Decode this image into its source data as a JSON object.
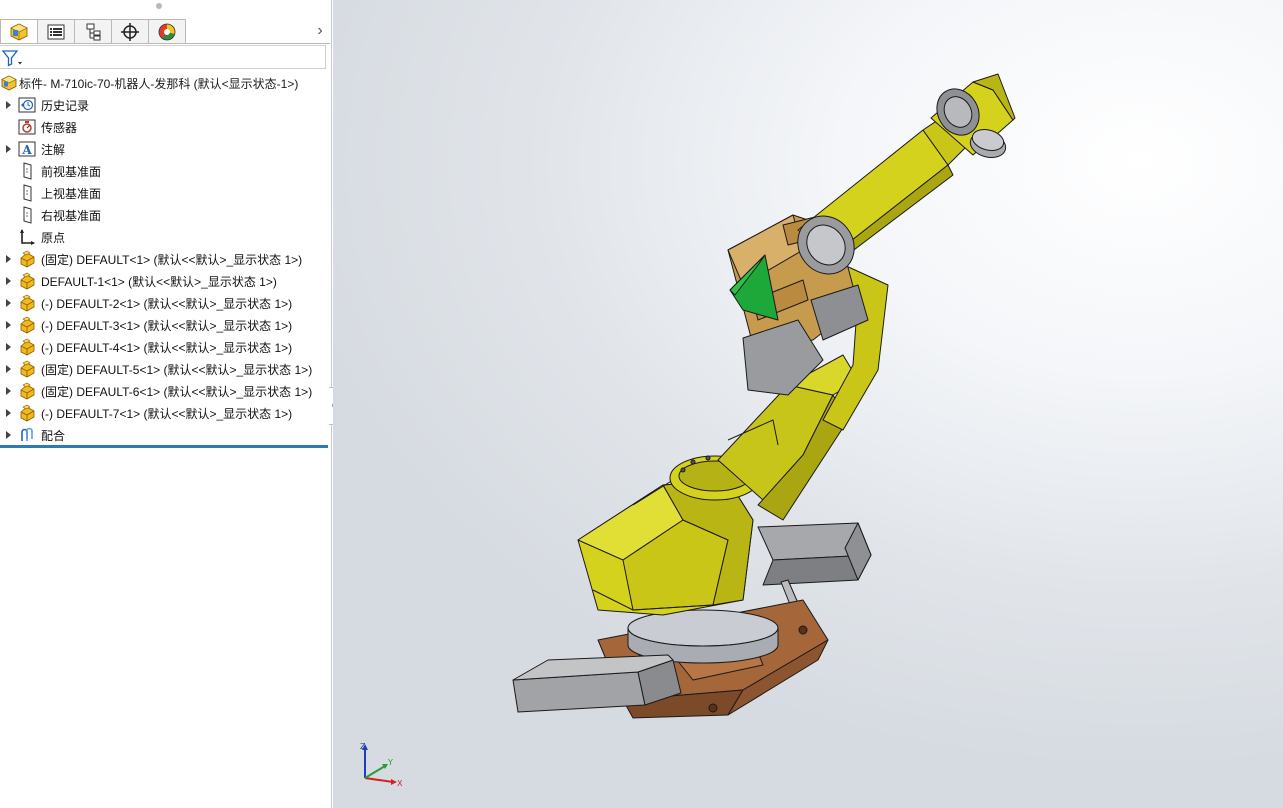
{
  "panel": {
    "tabs": [
      {
        "name": "feature-manager",
        "icon": "featuremanager-icon",
        "active": true
      },
      {
        "name": "property-manager",
        "icon": "propertymanager-icon",
        "active": false
      },
      {
        "name": "configuration-manager",
        "icon": "configurationmanager-icon",
        "active": false
      },
      {
        "name": "dimxpert-manager",
        "icon": "dimxpert-icon",
        "active": false
      },
      {
        "name": "display-manager",
        "icon": "displaymanager-icon",
        "active": false
      }
    ],
    "more_arrow": "›",
    "root_label": "标件- M-710ic-70-机器人-发那科 (默认<显示状态-1>)",
    "tree": [
      {
        "label": "历史记录",
        "icon": "history-icon",
        "expandable": true
      },
      {
        "label": "传感器",
        "icon": "sensor-icon",
        "expandable": false
      },
      {
        "label": "注解",
        "icon": "annotation-icon",
        "expandable": true
      },
      {
        "label": "前视基准面",
        "icon": "plane-icon",
        "expandable": false
      },
      {
        "label": "上视基准面",
        "icon": "plane-icon",
        "expandable": false
      },
      {
        "label": "右视基准面",
        "icon": "plane-icon",
        "expandable": false
      },
      {
        "label": "原点",
        "icon": "origin-icon",
        "expandable": false
      },
      {
        "label": "(固定) DEFAULT<1> (默认<<默认>_显示状态 1>)",
        "icon": "part-icon",
        "expandable": true
      },
      {
        "label": "DEFAULT-1<1> (默认<<默认>_显示状态 1>)",
        "icon": "part-icon",
        "expandable": true
      },
      {
        "label": "(-) DEFAULT-2<1> (默认<<默认>_显示状态 1>)",
        "icon": "part-icon",
        "expandable": true
      },
      {
        "label": "(-) DEFAULT-3<1> (默认<<默认>_显示状态 1>)",
        "icon": "part-icon",
        "expandable": true
      },
      {
        "label": "(-) DEFAULT-4<1> (默认<<默认>_显示状态 1>)",
        "icon": "part-icon",
        "expandable": true
      },
      {
        "label": "(固定) DEFAULT-5<1> (默认<<默认>_显示状态 1>)",
        "icon": "part-icon",
        "expandable": true
      },
      {
        "label": "(固定) DEFAULT-6<1> (默认<<默认>_显示状态 1>)",
        "icon": "part-icon",
        "expandable": true
      },
      {
        "label": "(-) DEFAULT-7<1> (默认<<默认>_显示状态 1>)",
        "icon": "part-icon",
        "expandable": true
      },
      {
        "label": "配合",
        "icon": "mates-icon",
        "expandable": true
      }
    ]
  },
  "viewport": {
    "triad": {
      "z": "Z",
      "y": "Y",
      "x": "X"
    },
    "colors": {
      "robot_yellow": "#d4d21c",
      "robot_dark_yellow": "#a9a612",
      "base_brown": "#a5663a",
      "grey_metal": "#9a9b9e",
      "accent_green": "#1fa83a",
      "joint_tan": "#c69b4e"
    }
  }
}
